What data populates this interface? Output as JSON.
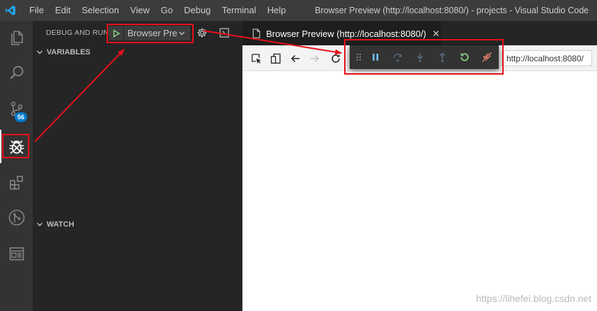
{
  "titlebar": {
    "menu": [
      "File",
      "Edit",
      "Selection",
      "View",
      "Go",
      "Debug",
      "Terminal",
      "Help"
    ],
    "window_title": "Browser Preview (http://localhost:8080/) - projects - Visual Studio Code"
  },
  "activity_bar": {
    "items": [
      {
        "icon": "files-icon"
      },
      {
        "icon": "search-icon"
      },
      {
        "icon": "source-control-icon",
        "badge": "56"
      },
      {
        "icon": "debug-icon",
        "active": true
      },
      {
        "icon": "extensions-icon"
      },
      {
        "icon": "git-graph-icon"
      },
      {
        "icon": "browser-preview-icon"
      }
    ]
  },
  "sidebar": {
    "title": "DEBUG AND RUN",
    "config_name": "Browser Preview",
    "sections": {
      "variables": "VARIABLES",
      "watch": "WATCH"
    }
  },
  "editor": {
    "tab_label": "Browser Preview (http://localhost:8080/)"
  },
  "browser_toolbar": {
    "url": "http://localhost:8080/"
  },
  "debug_toolbar": {
    "buttons": [
      "drag-handle-icon",
      "pause-icon",
      "step-over-icon",
      "step-into-icon",
      "step-out-icon",
      "restart-icon",
      "disconnect-icon"
    ]
  },
  "colors": {
    "accent": "#007acc",
    "annotation": "#e8101a",
    "play_green": "#89d185",
    "restart_green": "#89d185",
    "disconnect_red": "#f48771",
    "debug_blue": "#75beff"
  },
  "watermark": "https://lihefei.blog.csdn.net"
}
